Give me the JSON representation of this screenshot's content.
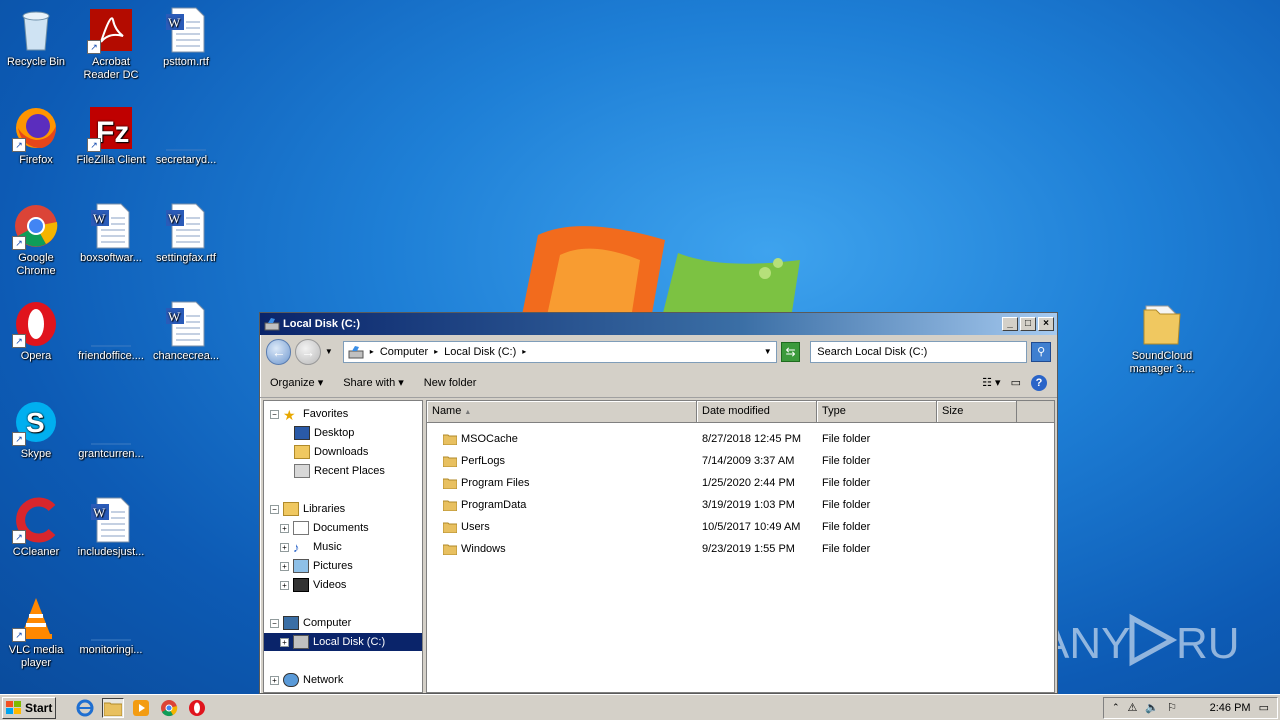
{
  "desktop": {
    "icons": [
      {
        "label": "Recycle Bin",
        "icon": "recycle-bin"
      },
      {
        "label": "Acrobat Reader DC",
        "icon": "acrobat"
      },
      {
        "label": "psttom.rtf",
        "icon": "word-doc"
      },
      {
        "label": "Firefox",
        "icon": "firefox"
      },
      {
        "label": "FileZilla Client",
        "icon": "filezilla"
      },
      {
        "label": "secretaryd...",
        "icon": "blank-doc"
      },
      {
        "label": "Google Chrome",
        "icon": "chrome"
      },
      {
        "label": "boxsoftwar...",
        "icon": "word-doc"
      },
      {
        "label": "settingfax.rtf",
        "icon": "word-doc"
      },
      {
        "label": "Opera",
        "icon": "opera"
      },
      {
        "label": "friendoffice....",
        "icon": "blank-doc"
      },
      {
        "label": "chancecrea...",
        "icon": "word-doc"
      },
      {
        "label": "Skype",
        "icon": "skype"
      },
      {
        "label": "grantcurren...",
        "icon": "blank-doc"
      },
      {
        "label": "CCleaner",
        "icon": "ccleaner"
      },
      {
        "label": "includesjust...",
        "icon": "word-doc"
      },
      {
        "label": "VLC media player",
        "icon": "vlc"
      },
      {
        "label": "monitoringi...",
        "icon": "blank-doc"
      },
      {
        "label": "SoundCloud manager 3....",
        "icon": "folder"
      }
    ]
  },
  "watermark": "ANY RUN",
  "window": {
    "title": "Local Disk (C:)",
    "address": {
      "crumbs": [
        "Computer",
        "Local Disk (C:)"
      ]
    },
    "search_placeholder": "Search Local Disk (C:)",
    "toolbar": {
      "organize": "Organize",
      "share": "Share with",
      "new_folder": "New folder"
    },
    "nav": {
      "favorites": "Favorites",
      "desktop": "Desktop",
      "downloads": "Downloads",
      "recent": "Recent Places",
      "libraries": "Libraries",
      "documents": "Documents",
      "music": "Music",
      "pictures": "Pictures",
      "videos": "Videos",
      "computer": "Computer",
      "local_disk": "Local Disk (C:)",
      "network": "Network"
    },
    "columns": {
      "name": "Name",
      "date": "Date modified",
      "type": "Type",
      "size": "Size"
    },
    "files": [
      {
        "name": "MSOCache",
        "date": "8/27/2018 12:45 PM",
        "type": "File folder"
      },
      {
        "name": "PerfLogs",
        "date": "7/14/2009 3:37 AM",
        "type": "File folder"
      },
      {
        "name": "Program Files",
        "date": "1/25/2020 2:44 PM",
        "type": "File folder"
      },
      {
        "name": "ProgramData",
        "date": "3/19/2019 1:03 PM",
        "type": "File folder"
      },
      {
        "name": "Users",
        "date": "10/5/2017 10:49 AM",
        "type": "File folder"
      },
      {
        "name": "Windows",
        "date": "9/23/2019 1:55 PM",
        "type": "File folder"
      }
    ]
  },
  "taskbar": {
    "start": "Start",
    "clock": "2:46 PM"
  }
}
